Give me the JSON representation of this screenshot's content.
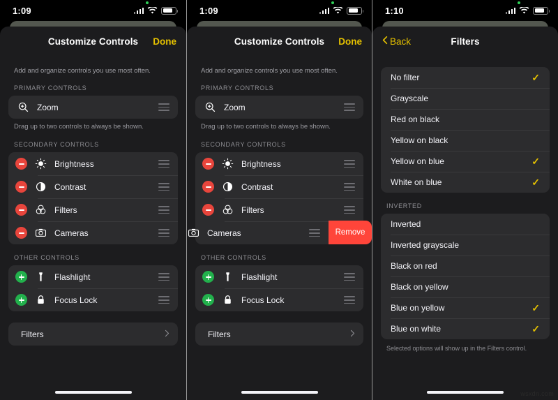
{
  "watermark": "wsxdn.com",
  "panels": [
    {
      "status": {
        "time": "1:09",
        "icons": [
          "recording-dot",
          "cellular-bars",
          "wifi",
          "battery"
        ]
      },
      "nav": {
        "title": "Customize Controls",
        "right_label": "Done"
      },
      "intro": "Add and organize controls you use most often.",
      "sections": [
        {
          "header": "PRIMARY CONTROLS",
          "rows": [
            {
              "label": "Zoom",
              "icon": "zoom-in-icon",
              "action": "none",
              "handle": true
            }
          ],
          "hint": "Drag up to two controls to always be shown."
        },
        {
          "header": "SECONDARY CONTROLS",
          "rows": [
            {
              "label": "Brightness",
              "icon": "brightness-icon",
              "action": "remove",
              "handle": true
            },
            {
              "label": "Contrast",
              "icon": "contrast-icon",
              "action": "remove",
              "handle": true
            },
            {
              "label": "Filters",
              "icon": "filters-icon",
              "action": "remove",
              "handle": true
            },
            {
              "label": "Cameras",
              "icon": "camera-icon",
              "action": "remove",
              "handle": true
            }
          ]
        },
        {
          "header": "OTHER CONTROLS",
          "rows": [
            {
              "label": "Flashlight",
              "icon": "flashlight-icon",
              "action": "add",
              "handle": true
            },
            {
              "label": "Focus Lock",
              "icon": "lock-icon",
              "action": "add",
              "handle": true
            }
          ]
        }
      ],
      "link_row": {
        "label": "Filters",
        "accessory": "chevron-right-icon"
      }
    },
    {
      "status": {
        "time": "1:09",
        "icons": [
          "recording-dot",
          "cellular-bars",
          "wifi",
          "battery"
        ]
      },
      "nav": {
        "title": "Customize Controls",
        "right_label": "Done"
      },
      "intro": "Add and organize controls you use most often.",
      "sections": [
        {
          "header": "PRIMARY CONTROLS",
          "rows": [
            {
              "label": "Zoom",
              "icon": "zoom-in-icon",
              "action": "none",
              "handle": true
            }
          ],
          "hint": "Drag up to two controls to always be shown."
        },
        {
          "header": "SECONDARY CONTROLS",
          "rows": [
            {
              "label": "Brightness",
              "icon": "brightness-icon",
              "action": "remove",
              "handle": true
            },
            {
              "label": "Contrast",
              "icon": "contrast-icon",
              "action": "remove",
              "handle": true
            },
            {
              "label": "Filters",
              "icon": "filters-icon",
              "action": "remove",
              "handle": true
            },
            {
              "label": "Cameras",
              "icon": "camera-icon",
              "action": "swiped",
              "handle": true,
              "swipe_action_label": "Remove"
            }
          ]
        },
        {
          "header": "OTHER CONTROLS",
          "rows": [
            {
              "label": "Flashlight",
              "icon": "flashlight-icon",
              "action": "add",
              "handle": true
            },
            {
              "label": "Focus Lock",
              "icon": "lock-icon",
              "action": "add",
              "handle": true
            }
          ]
        }
      ],
      "link_row": {
        "label": "Filters",
        "accessory": "chevron-right-icon"
      }
    },
    {
      "status": {
        "time": "1:10",
        "icons": [
          "recording-dot",
          "cellular-bars",
          "wifi",
          "battery"
        ]
      },
      "nav": {
        "title": "Filters",
        "back_label": "Back",
        "back_icon": "chevron-left-icon"
      },
      "groups": [
        {
          "header": "",
          "items": [
            {
              "label": "No filter",
              "checked": true
            },
            {
              "label": "Grayscale",
              "checked": false
            },
            {
              "label": "Red on black",
              "checked": false
            },
            {
              "label": "Yellow on black",
              "checked": false
            },
            {
              "label": "Yellow on blue",
              "checked": true
            },
            {
              "label": "White on blue",
              "checked": true
            }
          ]
        },
        {
          "header": "INVERTED",
          "items": [
            {
              "label": "Inverted",
              "checked": false
            },
            {
              "label": "Inverted grayscale",
              "checked": false
            },
            {
              "label": "Black on red",
              "checked": false
            },
            {
              "label": "Black on yellow",
              "checked": false
            },
            {
              "label": "Blue on yellow",
              "checked": true
            },
            {
              "label": "Blue on white",
              "checked": true
            }
          ]
        }
      ],
      "caption": "Selected options will show up in the Filters control."
    }
  ],
  "colors": {
    "accent_yellow": "#e5c100",
    "remove_red": "#e8453c",
    "swipe_red": "#ff453a",
    "add_green": "#22b14c",
    "sheet_bg": "#1c1c1e",
    "card_bg": "#2c2c2e"
  }
}
